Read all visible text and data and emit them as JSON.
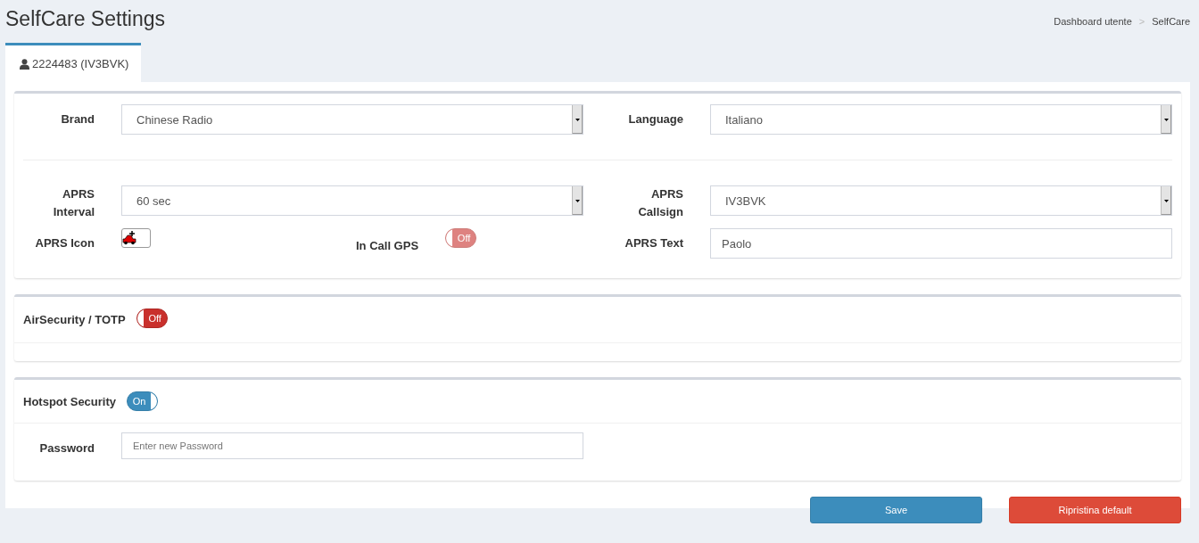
{
  "page_title": "SelfCare Settings",
  "breadcrumb": [
    {
      "label": "Dashboard utente"
    },
    {
      "label": "SelfCare"
    }
  ],
  "breadcrumb_separator": ">",
  "tabs": [
    {
      "label": "2224483 (IV3BVK)",
      "selected": true
    }
  ],
  "settings_panel": {
    "rows": [
      [
        {
          "label": "Brand",
          "kind": "select",
          "value": "Chinese Radio"
        },
        {
          "label": "Language",
          "kind": "select",
          "value": "Italiano"
        }
      ],
      [
        {
          "label": "APRS Interval",
          "kind": "select",
          "value": "60 sec"
        },
        {
          "label": "APRS Callsign",
          "kind": "select",
          "value": "IV3BVK"
        }
      ],
      [
        {
          "label": "APRS Icon",
          "kind": "icon"
        },
        {
          "label": "In Call GPS",
          "kind": "toggle",
          "on": false,
          "disabled": true,
          "text": "Off"
        },
        {
          "label": "APRS Text",
          "kind": "text",
          "value": "Paolo"
        }
      ]
    ]
  },
  "air_security": {
    "title": "AirSecurity / TOTP",
    "toggle": {
      "on": false,
      "disabled": false,
      "text": "Off"
    }
  },
  "hotspot_security": {
    "title": "Hotspot Security",
    "toggle": {
      "on": true,
      "disabled": false,
      "text": "On"
    },
    "password": {
      "label": "Password",
      "placeholder": "Enter new Password"
    }
  },
  "buttons": [
    {
      "label": "Save",
      "kind": "primary"
    },
    {
      "label": "Ripristina default",
      "kind": "danger"
    }
  ]
}
